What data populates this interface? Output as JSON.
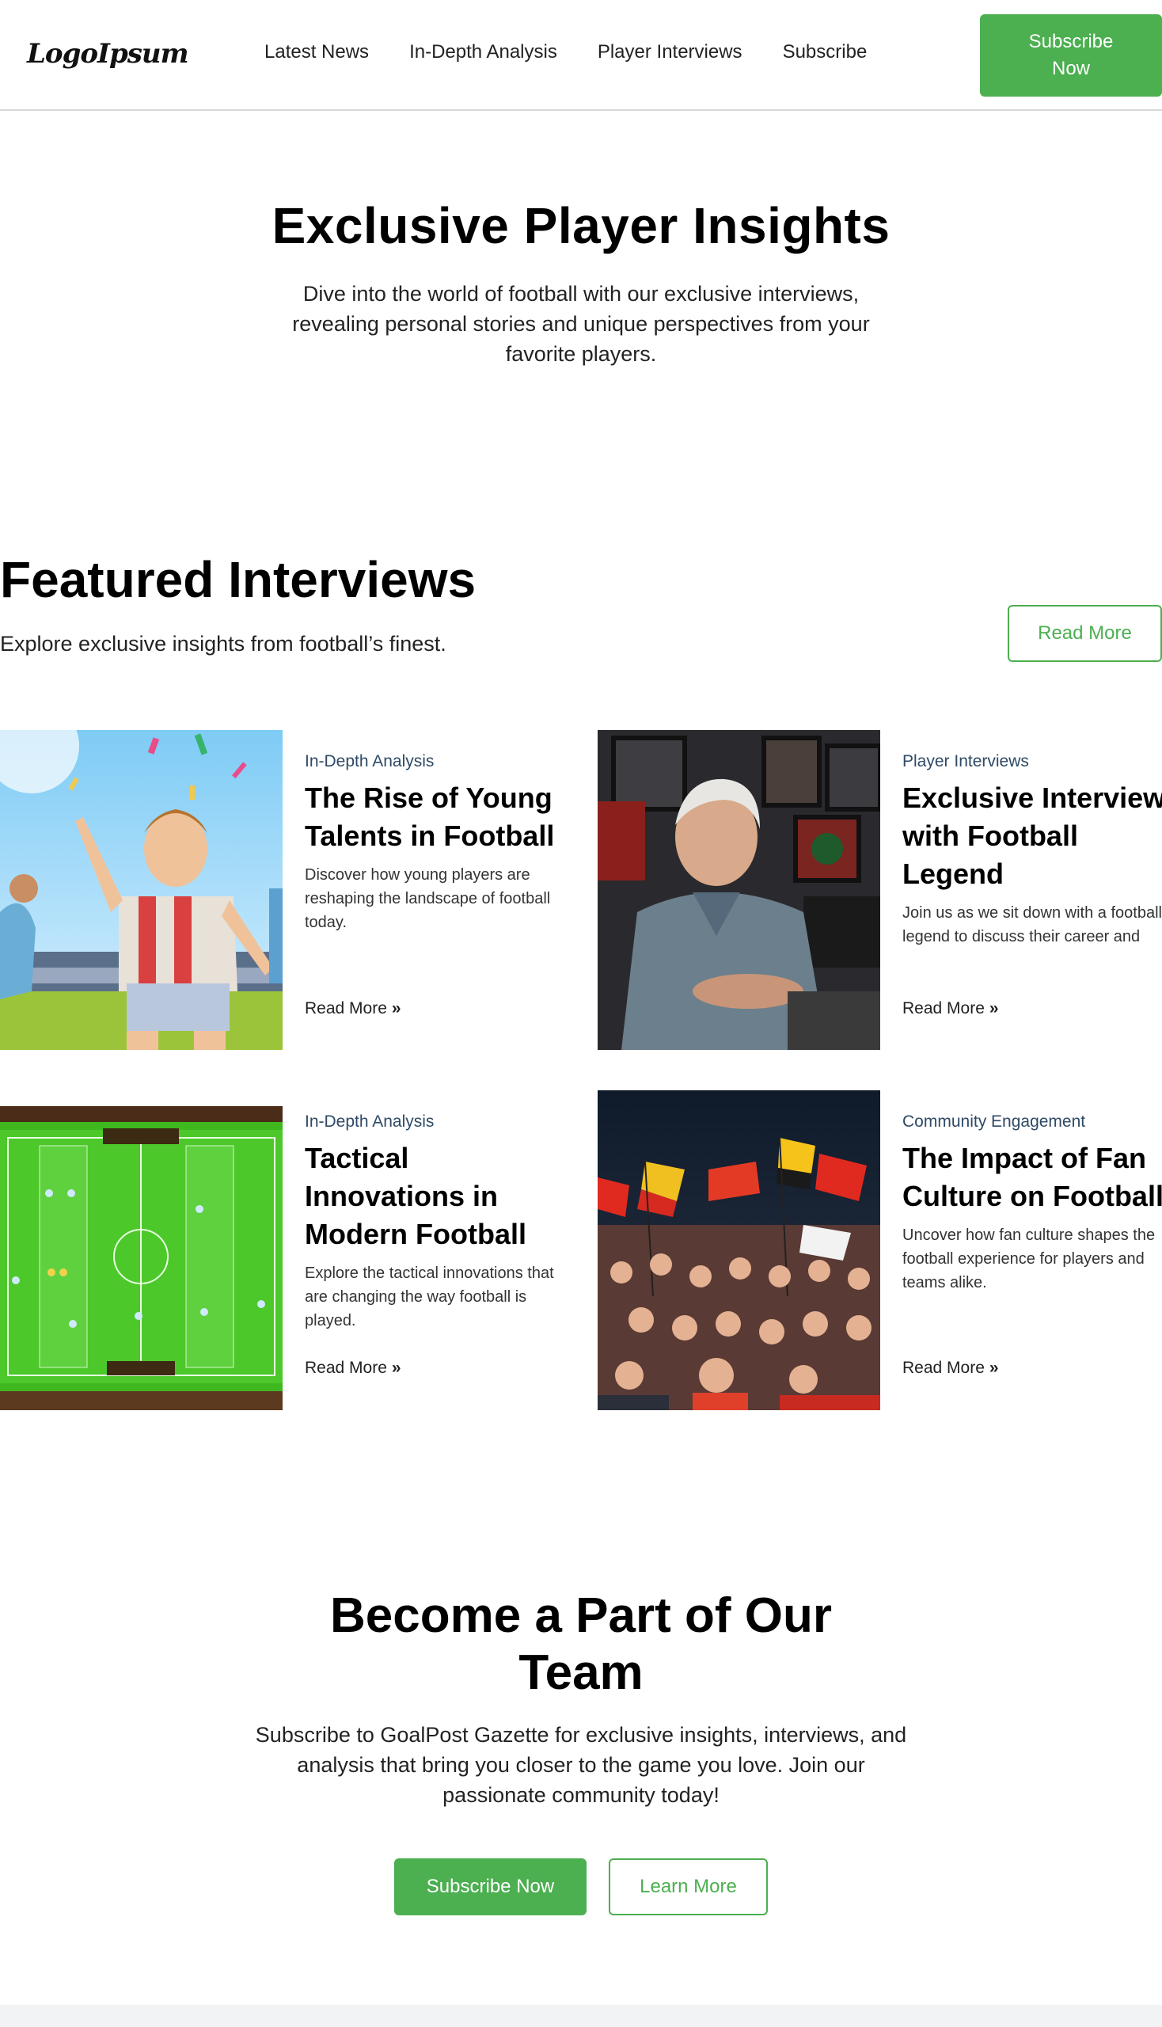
{
  "header": {
    "logo": "LogoIpsum",
    "nav": [
      "Latest News",
      "In-Depth Analysis",
      "Player Interviews",
      "Subscribe"
    ],
    "cta": "Subscribe Now"
  },
  "hero": {
    "title": "Exclusive Player Insights",
    "subtitle": "Dive into the world of football with our exclusive interviews, revealing personal stories and unique perspectives from your favorite players."
  },
  "featured": {
    "title": "Featured Interviews",
    "subtitle": "Explore exclusive insights from football’s finest.",
    "read_more": "Read More",
    "cards": [
      {
        "category": "In-Depth Analysis",
        "title": "The Rise of Young Talents in Football",
        "description": "Discover how young players are reshaping the landscape of football today.",
        "link": "Read More",
        "image": "young-player-celebrating-photo"
      },
      {
        "category": "Player Interviews",
        "title": "Exclusive Interview with Football Legend",
        "description": "Join us as we sit down with a football legend to discuss their career and",
        "link": "Read More",
        "image": "football-legend-portrait-photo"
      },
      {
        "category": "In-Depth Analysis",
        "title": "Tactical Innovations in Modern Football",
        "description": "Explore the tactical innovations that are changing the way football is played.",
        "link": "Read More",
        "image": "tactical-formation-board-photo"
      },
      {
        "category": "Community Engagement",
        "title": "The Impact of Fan Culture on Football",
        "description": "Uncover how fan culture shapes the football experience for players and teams alike.",
        "link": "Read More",
        "image": "fans-with-flags-photo"
      }
    ]
  },
  "cta": {
    "title": "Become a Part of Our Team",
    "subtitle": "Subscribe to GoalPost Gazette for exclusive insights, interviews, and analysis that bring you closer to the game you love. Join our passionate community today!",
    "primary": "Subscribe Now",
    "secondary": "Learn More"
  },
  "colors": {
    "accent": "#4caf50",
    "category": "#2f4a66"
  }
}
